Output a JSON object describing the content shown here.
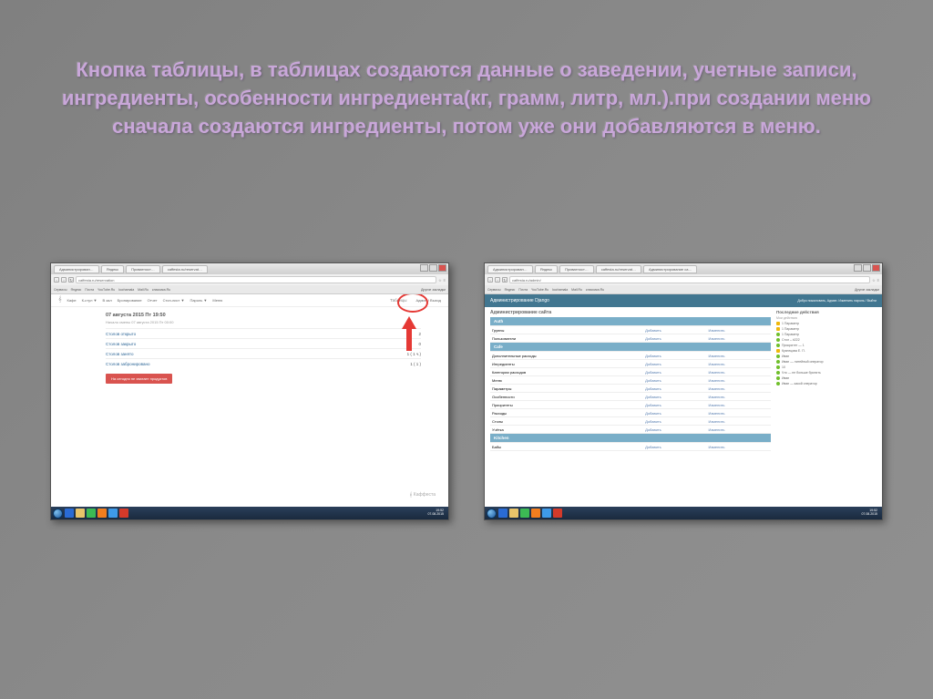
{
  "slide": {
    "title": "Кнопка таблицы, в таблицах создаются данные о заведении, учетные записи, ингредиенты, особенности ингредиента(кг, грамм, литр, мл.).при создании меню сначала создаются ингредиенты, потом уже они добавляются в меню."
  },
  "browser_common": {
    "tabs": [
      "Администрирован…",
      "Яндекс",
      "Приватност…",
      "caffesta.ru/reservat…"
    ],
    "url_left": "caffesta.ru/reservation",
    "url_right": "caffesta.ru/admin/",
    "tab_admin": "Администрирование са…",
    "bookmarks": [
      "Сервисы",
      "Яндекс",
      "Почта",
      "YouTube.Ru",
      "kuchamala",
      "Mail.Ru",
      "классика.Ru"
    ],
    "other_bookmarks": "Другие закладки"
  },
  "left_page": {
    "nav": [
      "Кафе",
      "К-стул ▼",
      "В зал",
      "Бронирование",
      "Отчет",
      "Стоп-лист ▼",
      "Пароль ▼",
      "Меню"
    ],
    "btn_tables": "Таблицы",
    "exit_link": "Админ / Выход",
    "date_heading": "07 августа 2015 Пт 19:50",
    "date_sub": "Начало смены 07 августа 2015 Пт 00:00",
    "rows": [
      {
        "label": "Столов открыто",
        "value": "2"
      },
      {
        "label": "Столов закрыто",
        "value": "0"
      },
      {
        "label": "Столов занято",
        "value": "1 ( 1 ч.)"
      },
      {
        "label": "Столов забронировано",
        "value": "1 ( 1 )"
      }
    ],
    "red_btn": "На сегодня не хватает продуктов",
    "brand": "Каффеста"
  },
  "right_page": {
    "header": "Администрирование Django",
    "header_right": "Добро пожаловать, Админ. Изменить пароль / Выйти",
    "site_admin": "Администрирование сайта",
    "add": "Добавить",
    "change": "Изменить",
    "auth_hdr": "Auth",
    "auth_rows": [
      "Группы",
      "Пользователи"
    ],
    "cafe_hdr": "Cafe",
    "cafe_rows": [
      "Дополнительные расходы",
      "Ингредиенты",
      "Категории расходов",
      "Меню",
      "Параметры",
      "Особенности",
      "Приоритеты",
      "Расходы",
      "Столы",
      "Учётка"
    ],
    "kitchen_hdr": "Kitchen",
    "kitchen_rows": [
      "Бабы"
    ],
    "recent_hdr": "Последние действия",
    "my_actions": "Мои действия",
    "actions": [
      {
        "t": "edit",
        "txt": "1 Параметр"
      },
      {
        "t": "edit",
        "txt": "1 Параметр"
      },
      {
        "t": "add",
        "txt": "1 Параметр"
      },
      {
        "t": "add",
        "txt": "Стол – #222"
      },
      {
        "t": "add",
        "txt": "Приоритет — 1"
      },
      {
        "t": "edit",
        "txt": "Кузнецова Е. П."
      },
      {
        "t": "add",
        "txt": "Иван"
      },
      {
        "t": "add",
        "txt": "Иван — литейный оператор"
      },
      {
        "t": "add",
        "txt": "10"
      },
      {
        "t": "add",
        "txt": "Что — не больше бронить"
      },
      {
        "t": "add",
        "txt": "Иван"
      },
      {
        "t": "add",
        "txt": "Иван — какой оператор"
      }
    ]
  },
  "taskbar": {
    "time": "19:52",
    "date": "07.08.2015",
    "icons": [
      "ie",
      "folder",
      "chrome",
      "wmp",
      "skype",
      "ya"
    ]
  }
}
